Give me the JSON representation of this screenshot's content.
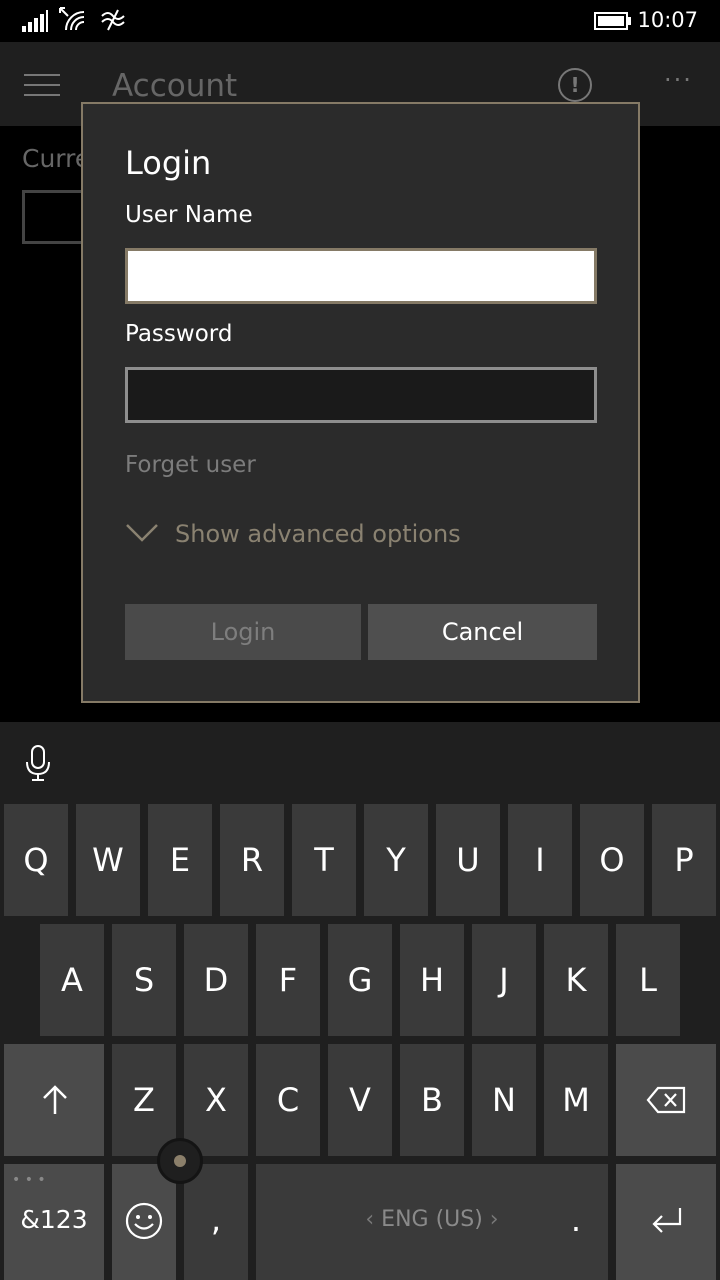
{
  "status_bar": {
    "time": "10:07"
  },
  "app_bar": {
    "title": "Account"
  },
  "background": {
    "label": "Curre"
  },
  "dialog": {
    "title": "Login",
    "username_label": "User Name",
    "username_value": "",
    "password_label": "Password",
    "password_value": "",
    "forget_user": "Forget user",
    "advanced_options": "Show advanced options",
    "login_button": "Login",
    "cancel_button": "Cancel"
  },
  "keyboard": {
    "row1": [
      "Q",
      "W",
      "E",
      "R",
      "T",
      "Y",
      "U",
      "I",
      "O",
      "P"
    ],
    "row2": [
      "A",
      "S",
      "D",
      "F",
      "G",
      "H",
      "J",
      "K",
      "L"
    ],
    "row3": [
      "Z",
      "X",
      "C",
      "V",
      "B",
      "N",
      "M"
    ],
    "symbols_key": "&123",
    "comma_key": ",",
    "space_label": "ENG (US)",
    "period_key": "."
  },
  "colors": {
    "accent": "#857a66",
    "dialog_bg": "#2b2b2b",
    "key_bg": "#3a3a3a",
    "key_special_bg": "#4b4b4b"
  },
  "icons": {
    "signal": "signal-bars-icon",
    "wifi": "wifi-icon",
    "battery": "battery-icon",
    "menu": "hamburger-menu-icon",
    "info": "info-icon",
    "more": "more-icon",
    "mic": "microphone-icon",
    "shift": "shift-arrow-icon",
    "backspace": "backspace-icon",
    "emoji": "emoji-icon",
    "enter": "enter-icon"
  }
}
